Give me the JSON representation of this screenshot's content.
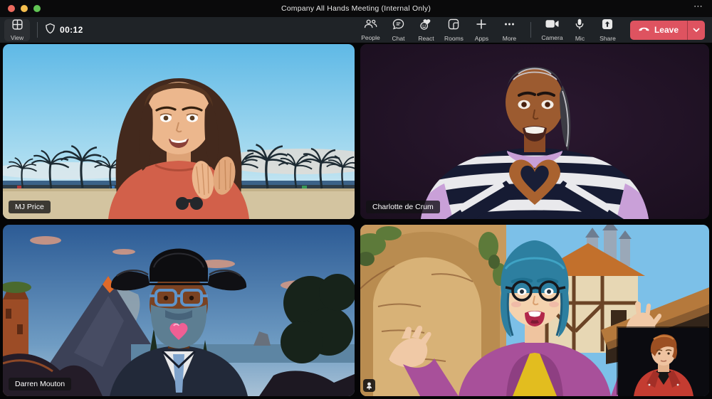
{
  "window": {
    "title": "Company All Hands Meeting (Internal Only)",
    "more_glyph": "⋯"
  },
  "toolbar": {
    "view_label": "View",
    "timer": "00:12",
    "buttons": [
      {
        "id": "people",
        "label": "People"
      },
      {
        "id": "chat",
        "label": "Chat"
      },
      {
        "id": "react",
        "label": "React"
      },
      {
        "id": "rooms",
        "label": "Rooms"
      },
      {
        "id": "apps",
        "label": "Apps"
      },
      {
        "id": "more",
        "label": "More"
      },
      {
        "id": "camera",
        "label": "Camera"
      },
      {
        "id": "mic",
        "label": "Mic"
      },
      {
        "id": "share",
        "label": "Share"
      }
    ],
    "leave_label": "Leave"
  },
  "participants": [
    {
      "name": "MJ Price",
      "scene": "beach-avatar"
    },
    {
      "name": "Charlotte de Crum",
      "scene": "dark-room-heart-hands-avatar"
    },
    {
      "name": "Darren Mouton",
      "scene": "mountain-cowboy-avatar"
    },
    {
      "name": "",
      "scene": "village-blue-hair-avatar",
      "self_pip": "red-jacket-avatar"
    }
  ],
  "colors": {
    "leave_red": "#de5360",
    "toolbar_bg": "#1f2327",
    "titlebar_bg": "#0a0a0b",
    "stage_bg": "#050506"
  }
}
